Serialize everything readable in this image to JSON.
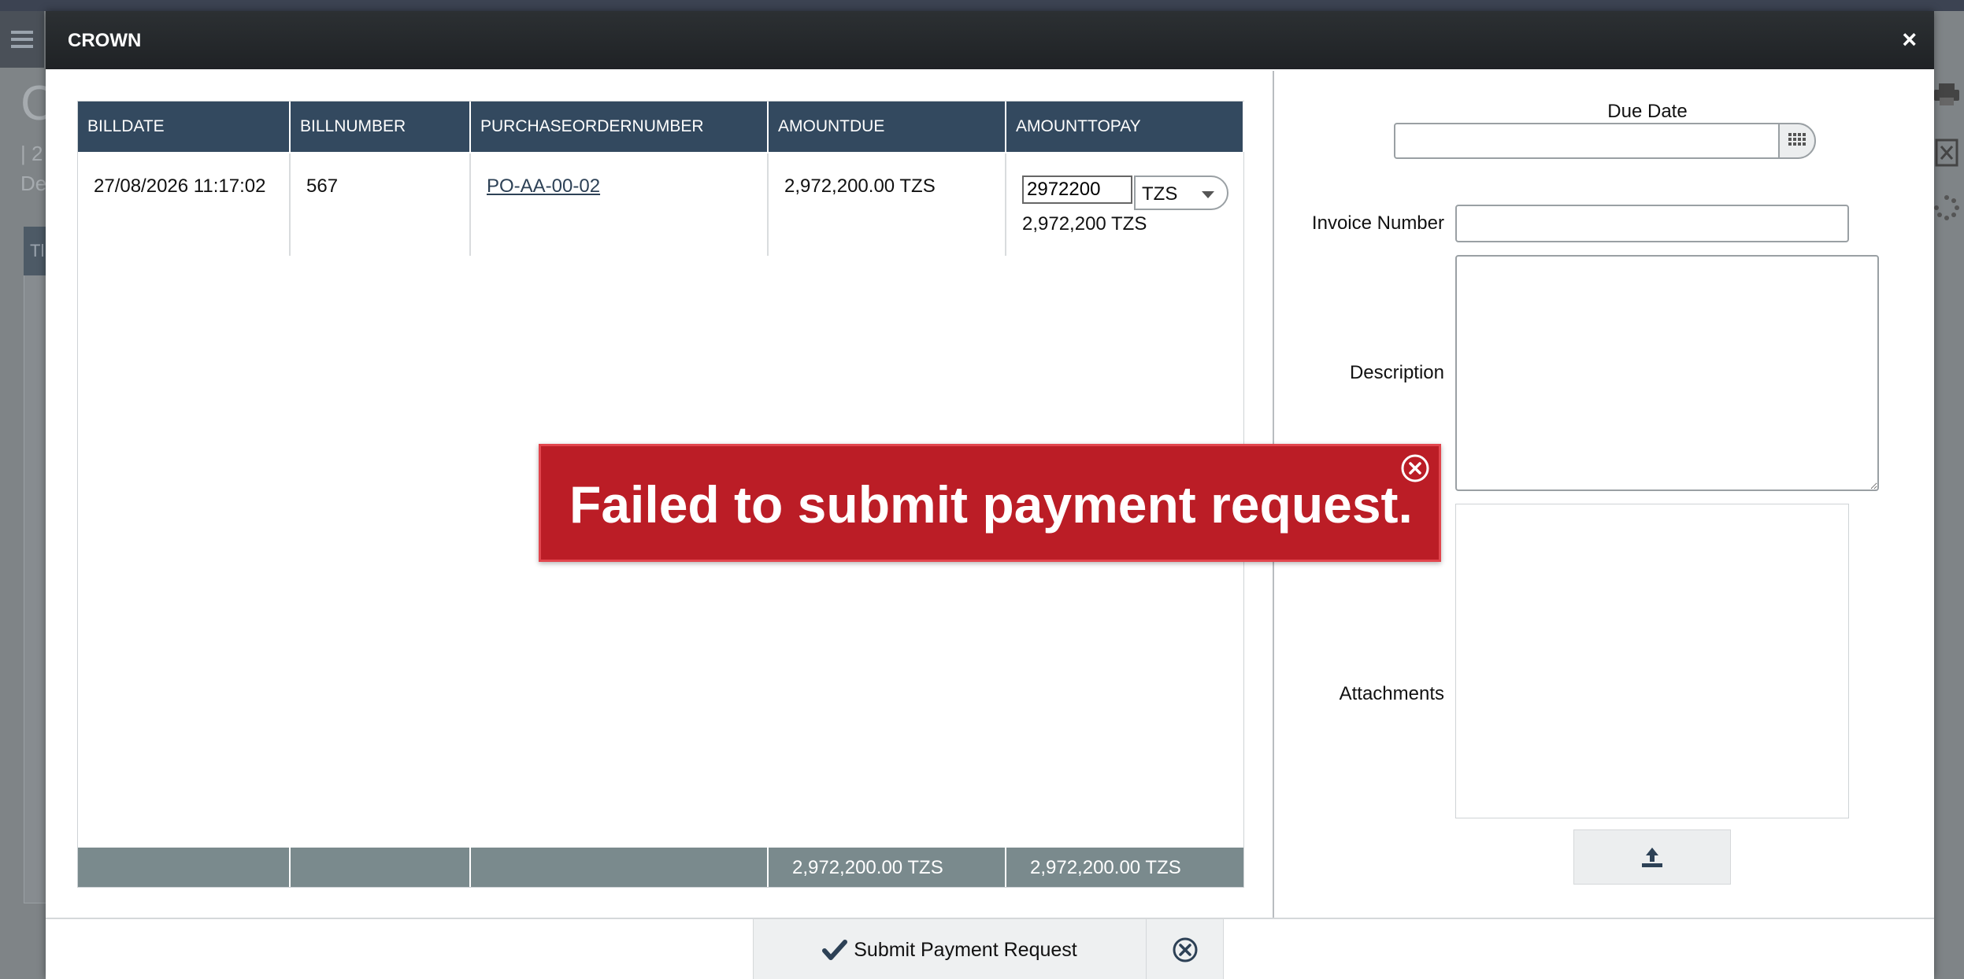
{
  "background": {
    "big_letter": "C",
    "line1": "| 2",
    "line2": "De",
    "panel_head": "Tl"
  },
  "modal": {
    "title": "CROWN",
    "close_glyph": "×"
  },
  "grid": {
    "columns": [
      "BILLDATE",
      "BILLNUMBER",
      "PURCHASEORDERNUMBER",
      "AMOUNTDUE",
      "AMOUNTTOPAY"
    ],
    "rows": [
      {
        "billdate": "27/08/2026 11:17:02",
        "billnumber": "567",
        "purchaseordernumber": "PO-AA-00-02",
        "amountdue": "2,972,200.00 TZS",
        "amounttopay_input": "2972200",
        "amounttopay_currency": "TZS",
        "amounttopay_text": "2,972,200 TZS"
      }
    ],
    "footer": {
      "amountdue_total": "2,972,200.00 TZS",
      "amounttopay_total": "2,972,200.00 TZS"
    }
  },
  "form": {
    "due_date_label": "Due Date",
    "due_date_value": "",
    "invoice_number_label": "Invoice Number",
    "invoice_number_value": "",
    "description_label": "Description",
    "description_value": "",
    "attachments_label": "Attachments"
  },
  "actions": {
    "submit_label": "Submit Payment Request"
  },
  "toast": {
    "message": "Failed to submit payment request."
  },
  "colors": {
    "header": "#1f2225",
    "grid_header": "#33495f",
    "grid_footer": "#7a8a8d",
    "error": "#bb1d26"
  }
}
